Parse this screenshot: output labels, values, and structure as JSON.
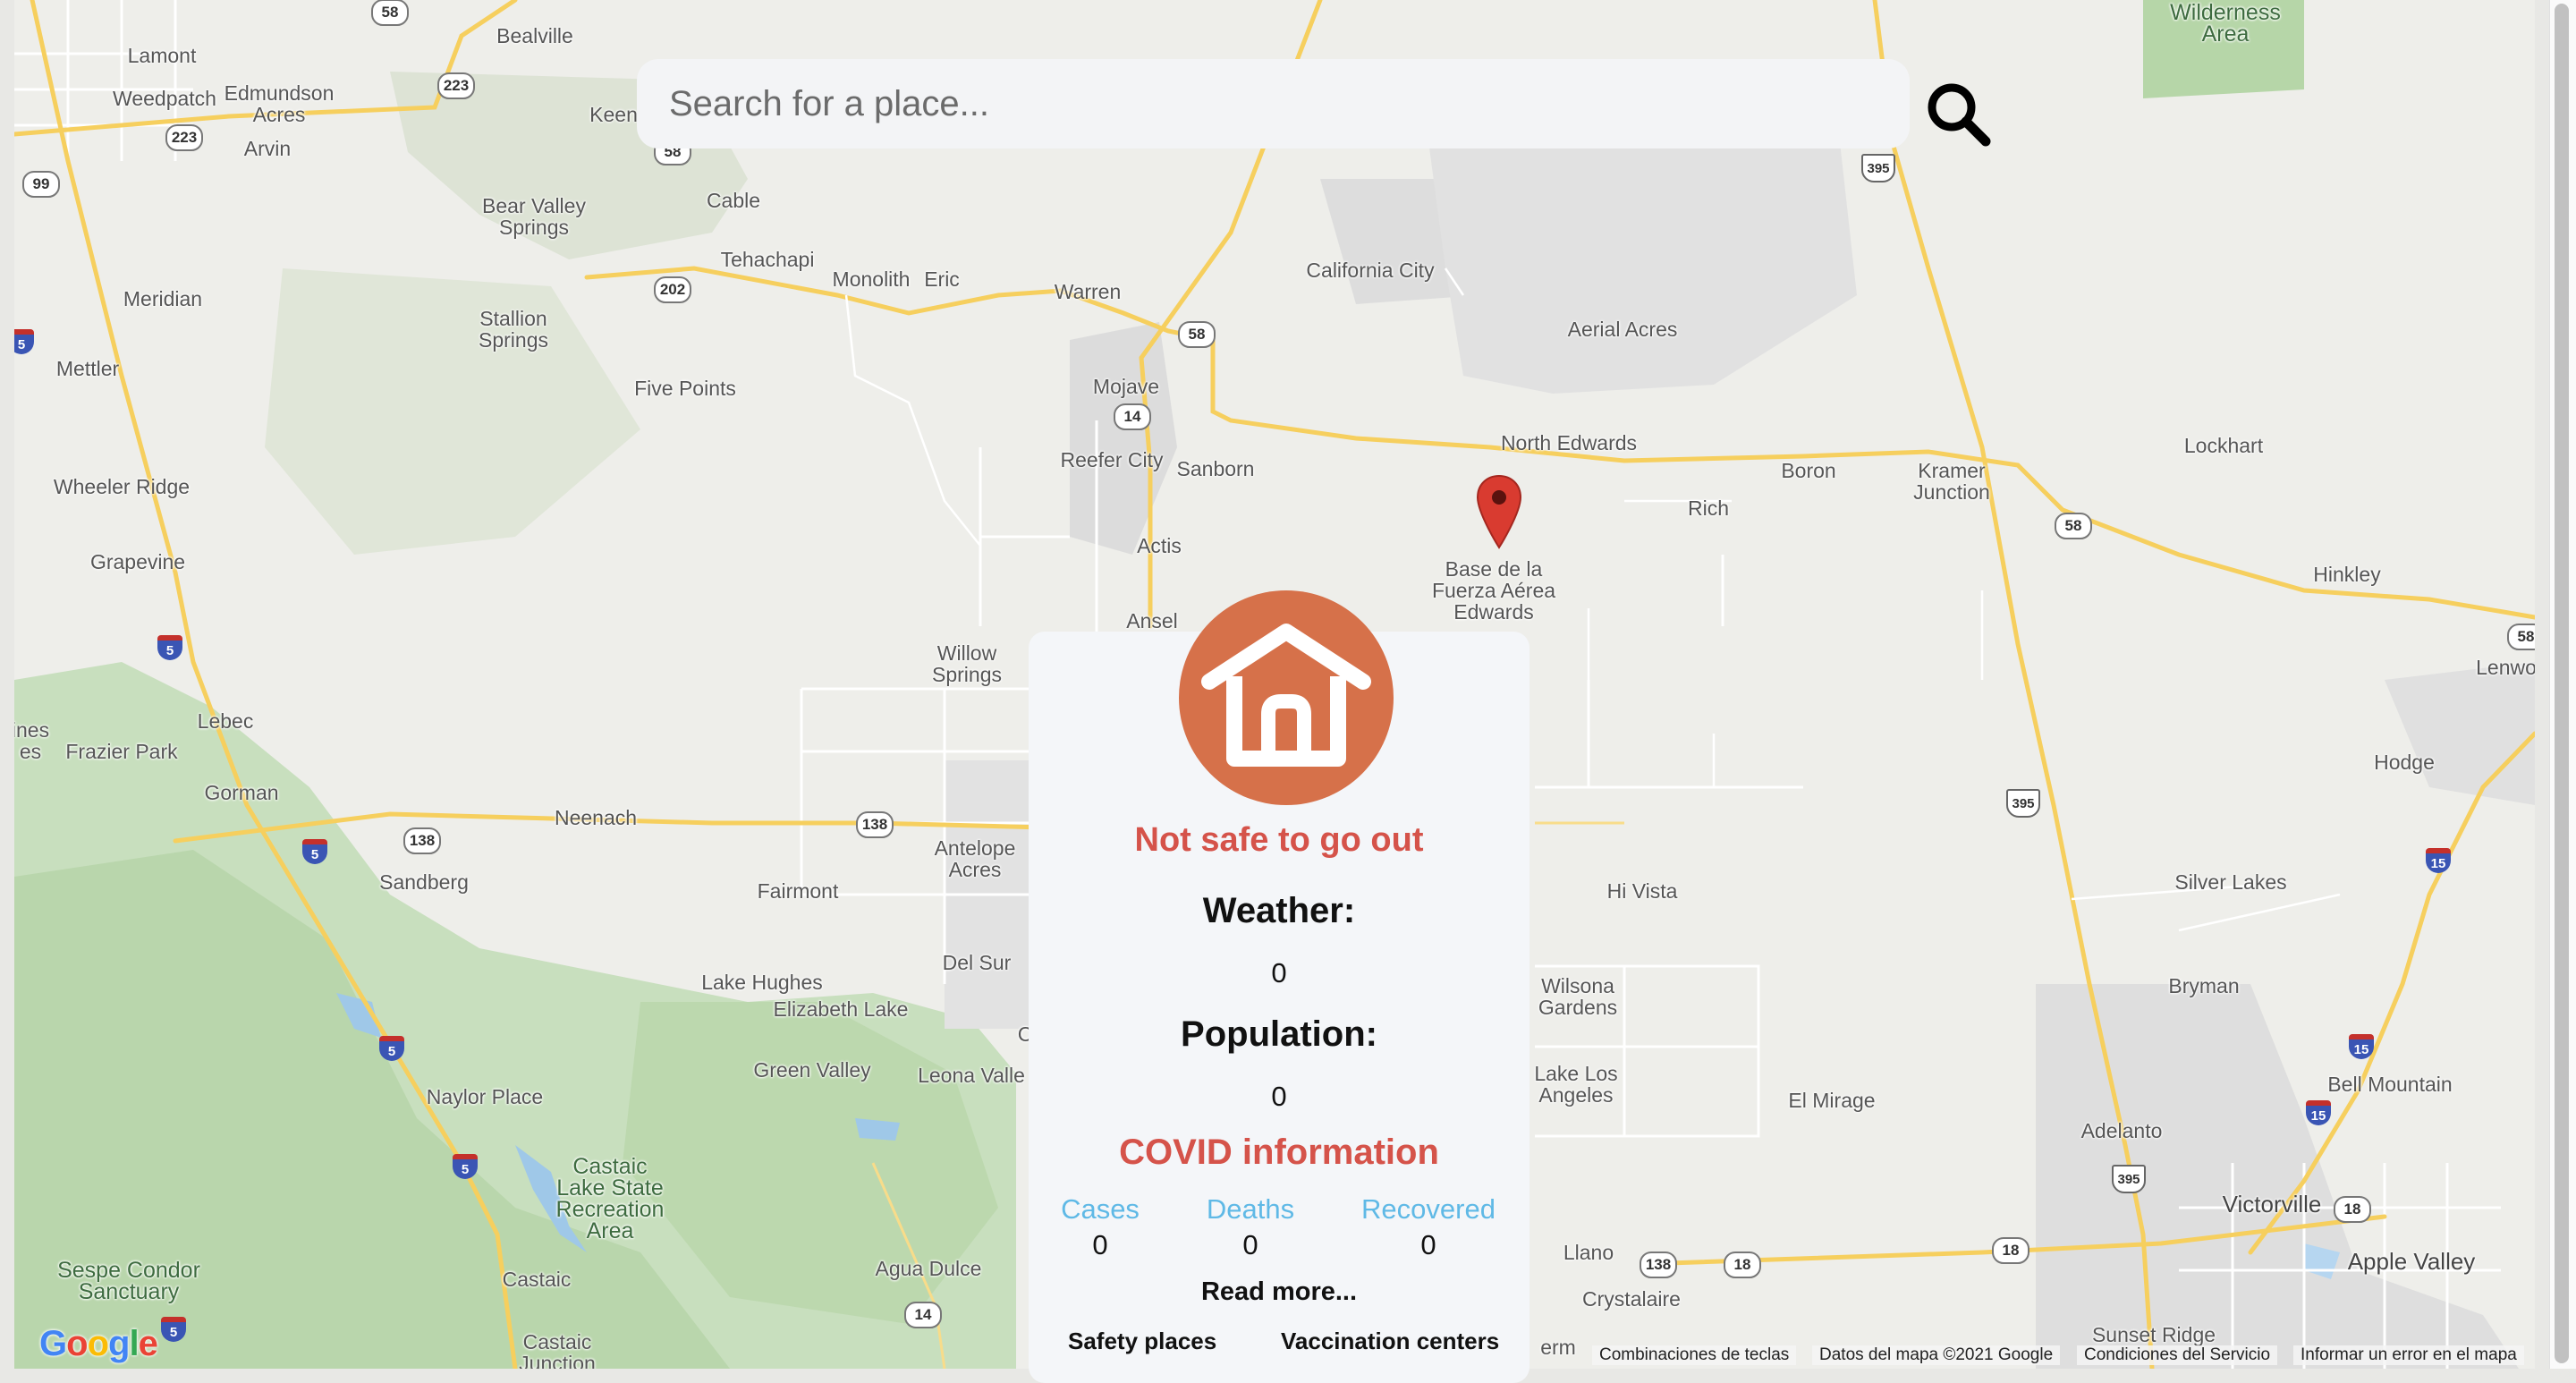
{
  "search": {
    "placeholder": "Search for a place..."
  },
  "map": {
    "places": [
      {
        "name": "Bealville"
      },
      {
        "name": "Lamont"
      },
      {
        "name": "Weedpatch"
      },
      {
        "name": "Edmundson\nAcres"
      },
      {
        "name": "Arvin"
      },
      {
        "name": "Keen"
      },
      {
        "name": "Cable"
      },
      {
        "name": "Bear Valley\nSprings"
      },
      {
        "name": "Tehachapi"
      },
      {
        "name": "Monolith"
      },
      {
        "name": "Eric"
      },
      {
        "name": "Meridian"
      },
      {
        "name": "Stallion\nSprings"
      },
      {
        "name": "Mettler"
      },
      {
        "name": "Five Points"
      },
      {
        "name": "Warren"
      },
      {
        "name": "California City"
      },
      {
        "name": "Aerial Acres"
      },
      {
        "name": "Mojave"
      },
      {
        "name": "Reefer City"
      },
      {
        "name": "Sanborn"
      },
      {
        "name": "North Edwards"
      },
      {
        "name": "Boron"
      },
      {
        "name": "Kramer\nJunction"
      },
      {
        "name": "Lockhart"
      },
      {
        "name": "Wheeler Ridge"
      },
      {
        "name": "Rich"
      },
      {
        "name": "Actis"
      },
      {
        "name": "Base de la\nFuerza Aérea\nEdwards"
      },
      {
        "name": "Grapevine"
      },
      {
        "name": "Hinkley"
      },
      {
        "name": "Ansel"
      },
      {
        "name": "Willow\nSprings"
      },
      {
        "name": "Lenwo"
      },
      {
        "name": "Lebec"
      },
      {
        "name": "ines\nes"
      },
      {
        "name": "Frazier Park"
      },
      {
        "name": "Hodge"
      },
      {
        "name": "Gorman"
      },
      {
        "name": "Neenach"
      },
      {
        "name": "Antelope\nAcres"
      },
      {
        "name": "Sandberg"
      },
      {
        "name": "Fairmont"
      },
      {
        "name": "Hi Vista"
      },
      {
        "name": "Silver Lakes"
      },
      {
        "name": "Del Sur"
      },
      {
        "name": "Lake Hughes"
      },
      {
        "name": "Elizabeth Lake"
      },
      {
        "name": "Bryman"
      },
      {
        "name": "Wilsona\nGardens"
      },
      {
        "name": "Green Valley"
      },
      {
        "name": "Leona Valle"
      },
      {
        "name": "Naylor Place"
      },
      {
        "name": "Lake Los\nAngeles"
      },
      {
        "name": "El Mirage"
      },
      {
        "name": "Bell Mountain"
      },
      {
        "name": "Adelanto"
      },
      {
        "name": "Victorville"
      },
      {
        "name": "Apple Valley"
      },
      {
        "name": "Llano"
      },
      {
        "name": "Agua Dulce"
      },
      {
        "name": "Crystalaire"
      },
      {
        "name": "Sunset Ridge"
      },
      {
        "name": "Castaic"
      },
      {
        "name": "Castaic\nJunction"
      },
      {
        "name": "erm"
      },
      {
        "name": "C"
      }
    ],
    "parks": [
      {
        "name": "Wilderness\nArea"
      },
      {
        "name": "Castaic\nLake State\nRecreation\nArea"
      },
      {
        "name": "Sespe Condor\nSanctuary"
      }
    ],
    "shields": [
      {
        "type": "state",
        "num": "58"
      },
      {
        "type": "state",
        "num": "223"
      },
      {
        "type": "state",
        "num": "223"
      },
      {
        "type": "state",
        "num": "99"
      },
      {
        "type": "state",
        "num": "58"
      },
      {
        "type": "state",
        "num": "202"
      },
      {
        "type": "state",
        "num": "58"
      },
      {
        "type": "state",
        "num": "14"
      },
      {
        "type": "us",
        "num": "395"
      },
      {
        "type": "state",
        "num": "58"
      },
      {
        "type": "int",
        "num": "5"
      },
      {
        "type": "int",
        "num": "5"
      },
      {
        "type": "state",
        "num": "138"
      },
      {
        "type": "int",
        "num": "5"
      },
      {
        "type": "state",
        "num": "138"
      },
      {
        "type": "us",
        "num": "395"
      },
      {
        "type": "int",
        "num": "15"
      },
      {
        "type": "int",
        "num": "5"
      },
      {
        "type": "int",
        "num": "5"
      },
      {
        "type": "int",
        "num": "15"
      },
      {
        "type": "int",
        "num": "15"
      },
      {
        "type": "us",
        "num": "395"
      },
      {
        "type": "state",
        "num": "18"
      },
      {
        "type": "state",
        "num": "138"
      },
      {
        "type": "state",
        "num": "18"
      },
      {
        "type": "state",
        "num": "18"
      },
      {
        "type": "state",
        "num": "14"
      },
      {
        "type": "int",
        "num": "5"
      },
      {
        "type": "state",
        "num": "58"
      }
    ],
    "logo_text": "Google",
    "attribution": [
      "Combinaciones de teclas",
      "Datos del mapa ©2021 Google",
      "Condiciones del Servicio",
      "Informar un error en el mapa"
    ]
  },
  "panel": {
    "status": "Not safe to go out",
    "weather_label": "Weather:",
    "weather_value": "0",
    "population_label": "Population:",
    "population_value": "0",
    "covid_title": "COVID information",
    "stats": [
      {
        "label": "Cases",
        "value": "0"
      },
      {
        "label": "Deaths",
        "value": "0"
      },
      {
        "label": "Recovered",
        "value": "0"
      }
    ],
    "read_more": "Read more...",
    "safety_places": "Safety places",
    "vaccination_centers": "Vaccination centers"
  },
  "colors": {
    "status_red": "#d5534a",
    "home_orange": "#d6714a",
    "stat_blue": "#5fb9e6",
    "marker_red": "#d93b30"
  },
  "icons": {
    "search": "search-icon",
    "home": "home-icon",
    "marker": "map-marker-icon"
  }
}
